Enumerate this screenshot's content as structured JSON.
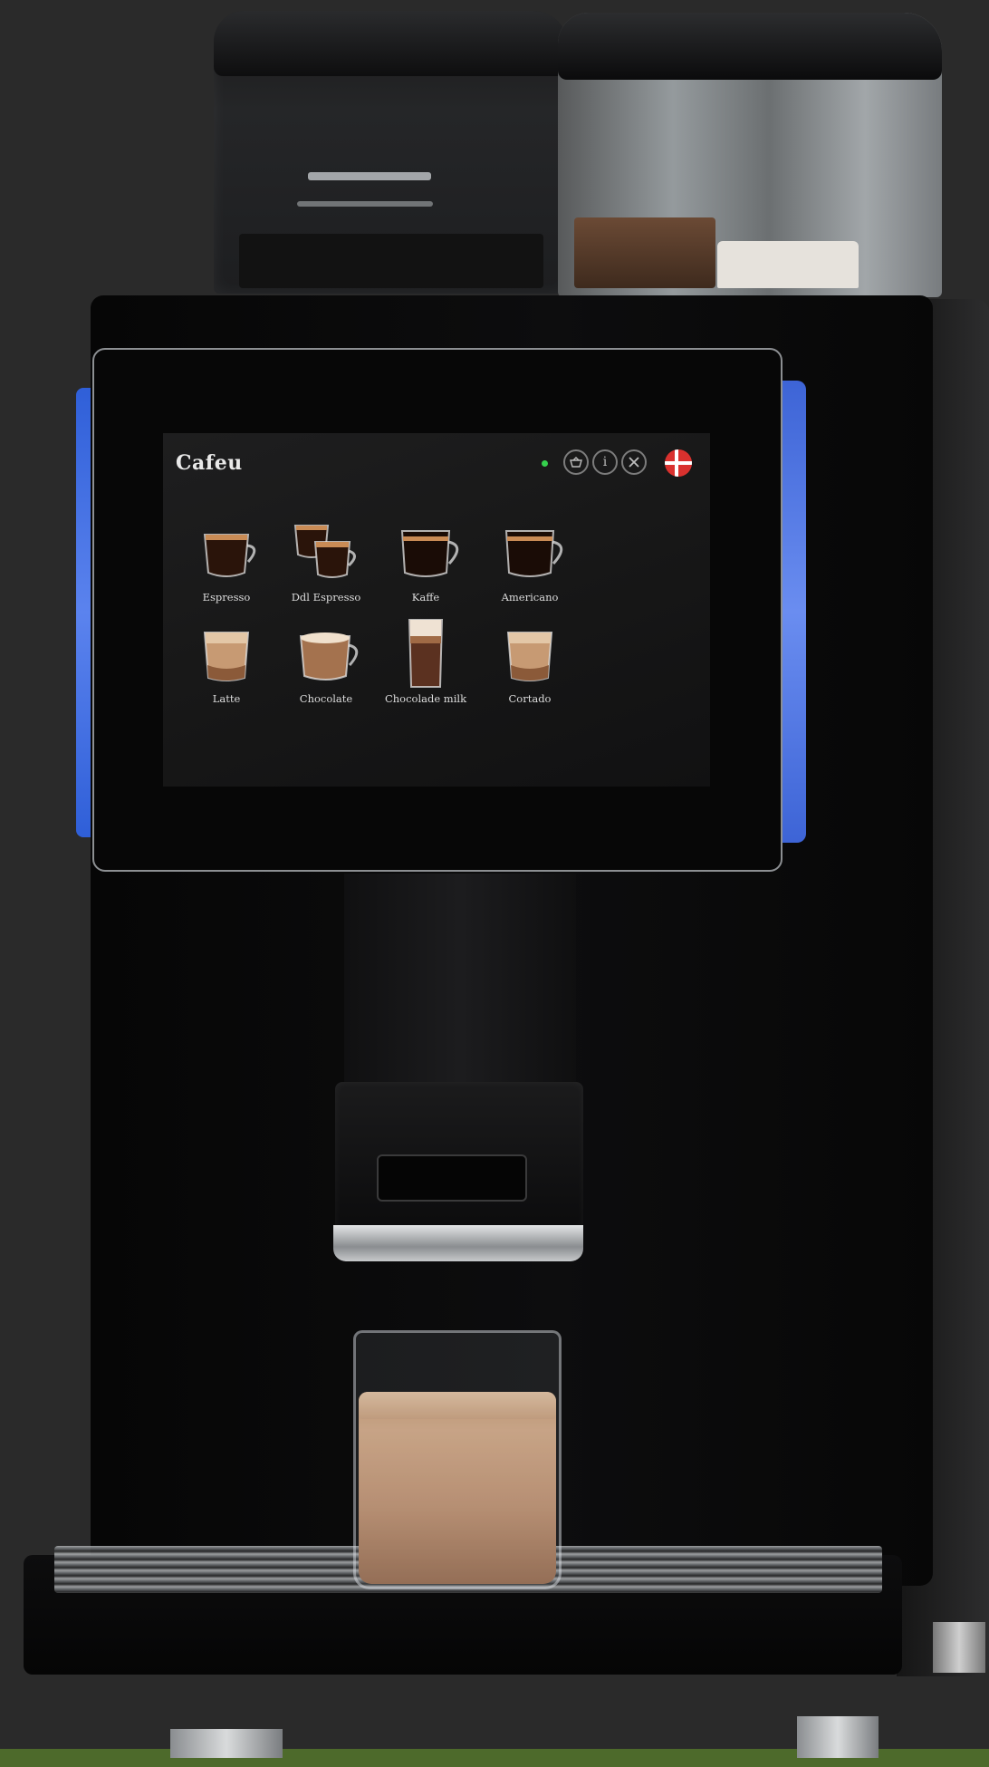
{
  "screen": {
    "brand": "Cafeu",
    "status_color": "#35d04d",
    "toolbar": [
      {
        "name": "basket-icon",
        "glyph": "⌂"
      },
      {
        "name": "info-icon",
        "glyph": "i"
      },
      {
        "name": "tools-icon",
        "glyph": "✕"
      },
      {
        "name": "danish-flag-icon",
        "glyph": ""
      }
    ],
    "drinks": [
      {
        "label": "Espresso",
        "cup": "espresso"
      },
      {
        "label": "Ddl Espresso",
        "cup": "double"
      },
      {
        "label": "Kaffe",
        "cup": "mug"
      },
      {
        "label": "Americano",
        "cup": "mug"
      },
      {
        "label": "Latte",
        "cup": "glass-short"
      },
      {
        "label": "Chocolate",
        "cup": "cappuccino"
      },
      {
        "label": "Chocolade milk",
        "cup": "glass-tall"
      },
      {
        "label": "Cortado",
        "cup": "glass-short"
      }
    ]
  },
  "colors": {
    "accent_blue": "#5b83ee",
    "flag_red": "#d9312e"
  }
}
